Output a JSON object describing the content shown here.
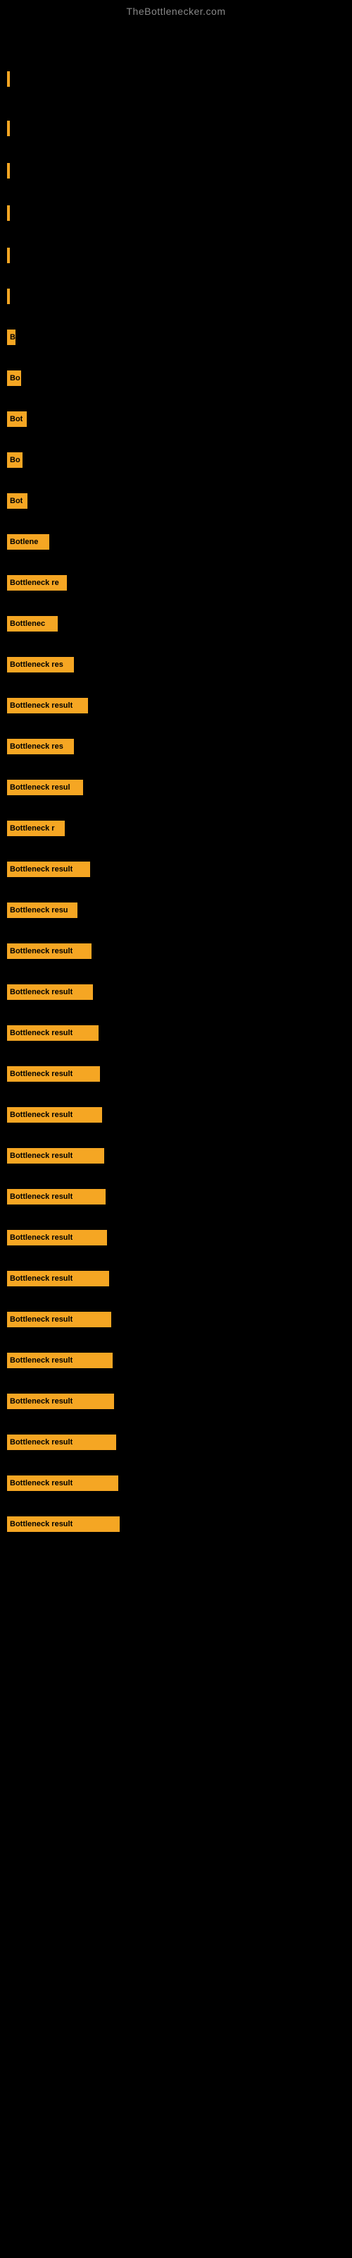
{
  "site": {
    "title": "TheBottlenecker.com"
  },
  "bars": [
    {
      "label": "",
      "width": 3,
      "gap_before": 60
    },
    {
      "label": "",
      "width": 3,
      "gap_before": 40
    },
    {
      "label": "",
      "width": 3,
      "gap_before": 30
    },
    {
      "label": "",
      "width": 3,
      "gap_before": 30
    },
    {
      "label": "",
      "width": 3,
      "gap_before": 30
    },
    {
      "label": "",
      "width": 4,
      "gap_before": 28
    },
    {
      "label": "B",
      "width": 12,
      "gap_before": 28
    },
    {
      "label": "Bo",
      "width": 20,
      "gap_before": 28
    },
    {
      "label": "Bot",
      "width": 28,
      "gap_before": 28
    },
    {
      "label": "Bo",
      "width": 22,
      "gap_before": 28
    },
    {
      "label": "Bot",
      "width": 29,
      "gap_before": 28
    },
    {
      "label": "Botlene",
      "width": 60,
      "gap_before": 28
    },
    {
      "label": "Bottleneck re",
      "width": 85,
      "gap_before": 28
    },
    {
      "label": "Bottlenec",
      "width": 72,
      "gap_before": 28
    },
    {
      "label": "Bottleneck res",
      "width": 95,
      "gap_before": 28
    },
    {
      "label": "Bottleneck result",
      "width": 115,
      "gap_before": 28
    },
    {
      "label": "Bottleneck res",
      "width": 95,
      "gap_before": 28
    },
    {
      "label": "Bottleneck resul",
      "width": 108,
      "gap_before": 28
    },
    {
      "label": "Bottleneck r",
      "width": 82,
      "gap_before": 28
    },
    {
      "label": "Bottleneck result",
      "width": 118,
      "gap_before": 28
    },
    {
      "label": "Bottleneck resu",
      "width": 100,
      "gap_before": 28
    },
    {
      "label": "Bottleneck result",
      "width": 120,
      "gap_before": 28
    },
    {
      "label": "Bottleneck result",
      "width": 122,
      "gap_before": 28
    },
    {
      "label": "Bottleneck result",
      "width": 130,
      "gap_before": 28
    },
    {
      "label": "Bottleneck result",
      "width": 132,
      "gap_before": 28
    },
    {
      "label": "Bottleneck result",
      "width": 135,
      "gap_before": 28
    },
    {
      "label": "Bottleneck result",
      "width": 138,
      "gap_before": 28
    },
    {
      "label": "Bottleneck result",
      "width": 140,
      "gap_before": 28
    },
    {
      "label": "Bottleneck result",
      "width": 142,
      "gap_before": 28
    },
    {
      "label": "Bottleneck result",
      "width": 145,
      "gap_before": 28
    },
    {
      "label": "Bottleneck result",
      "width": 148,
      "gap_before": 28
    },
    {
      "label": "Bottleneck result",
      "width": 150,
      "gap_before": 28
    },
    {
      "label": "Bottleneck result",
      "width": 152,
      "gap_before": 28
    },
    {
      "label": "Bottleneck result",
      "width": 155,
      "gap_before": 28
    },
    {
      "label": "Bottleneck result",
      "width": 158,
      "gap_before": 28
    },
    {
      "label": "Bottleneck result",
      "width": 160,
      "gap_before": 28
    }
  ]
}
